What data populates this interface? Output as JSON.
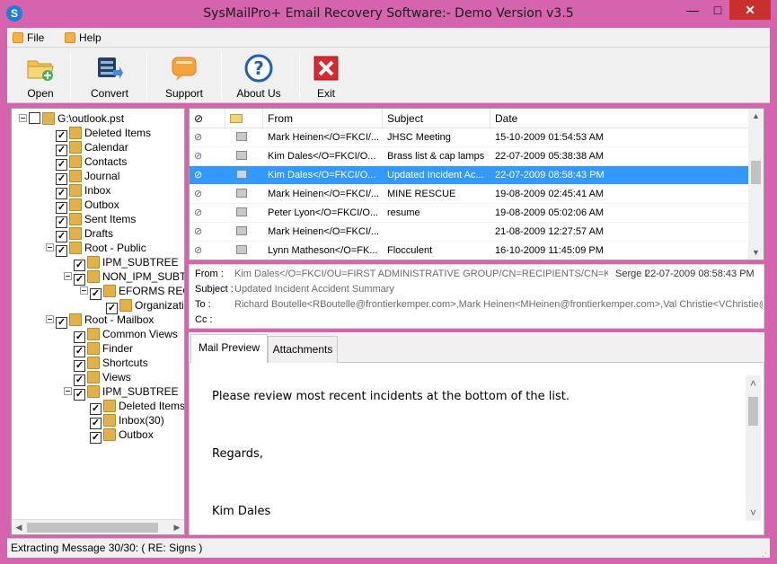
{
  "window": {
    "title": "SysMailPro+ Email Recovery Software:- Demo Version v3.5",
    "app_icon": "S",
    "controls": {
      "minimize": "—",
      "maximize": "□",
      "close": "✕"
    }
  },
  "menu": [
    {
      "label": "File",
      "icon": "file-menu-icon"
    },
    {
      "label": "Help",
      "icon": "help-menu-icon"
    }
  ],
  "toolbar": [
    {
      "label": "Open",
      "icon": "open-folder-icon"
    },
    {
      "label": "Convert",
      "icon": "convert-icon"
    },
    {
      "label": "Support",
      "icon": "support-chat-icon"
    },
    {
      "label": "About Us",
      "icon": "about-question-icon"
    },
    {
      "label": "Exit",
      "icon": "exit-x-icon"
    }
  ],
  "tree": {
    "items": [
      {
        "label": "G:\\outlook.pst",
        "depth": 0,
        "expander": true,
        "checked": false,
        "icon": "pst-file-icon"
      },
      {
        "label": "Deleted Items",
        "depth": 1,
        "expander": false,
        "checked": true,
        "icon": "recycle-folder-icon"
      },
      {
        "label": "Calendar",
        "depth": 1,
        "expander": false,
        "checked": true,
        "icon": "calendar-icon"
      },
      {
        "label": "Contacts",
        "depth": 1,
        "expander": false,
        "checked": true,
        "icon": "contacts-icon"
      },
      {
        "label": "Journal",
        "depth": 1,
        "expander": false,
        "checked": true,
        "icon": "journal-icon"
      },
      {
        "label": "Inbox",
        "depth": 1,
        "expander": false,
        "checked": true,
        "icon": "inbox-envelope-icon"
      },
      {
        "label": "Outbox",
        "depth": 1,
        "expander": false,
        "checked": true,
        "icon": "outbox-icon"
      },
      {
        "label": "Sent Items",
        "depth": 1,
        "expander": false,
        "checked": true,
        "icon": "sent-items-icon"
      },
      {
        "label": "Drafts",
        "depth": 1,
        "expander": false,
        "checked": true,
        "icon": "drafts-icon"
      },
      {
        "label": "Root - Public",
        "depth": 1,
        "expander": true,
        "checked": true,
        "icon": "folder-icon"
      },
      {
        "label": "IPM_SUBTREE",
        "depth": 2,
        "expander": false,
        "checked": true,
        "icon": "folder-icon"
      },
      {
        "label": "NON_IPM_SUBTREE",
        "depth": 2,
        "expander": true,
        "checked": true,
        "icon": "folder-icon"
      },
      {
        "label": "EFORMS REGISTRY",
        "depth": 3,
        "expander": true,
        "checked": true,
        "icon": "folder-icon"
      },
      {
        "label": "Organization Forms",
        "depth": 4,
        "expander": false,
        "checked": true,
        "icon": "folder-icon"
      },
      {
        "label": "Root - Mailbox",
        "depth": 1,
        "expander": true,
        "checked": true,
        "icon": "folder-icon"
      },
      {
        "label": "Common Views",
        "depth": 2,
        "expander": false,
        "checked": true,
        "icon": "folder-icon"
      },
      {
        "label": "Finder",
        "depth": 2,
        "expander": false,
        "checked": true,
        "icon": "folder-icon"
      },
      {
        "label": "Shortcuts",
        "depth": 2,
        "expander": false,
        "checked": true,
        "icon": "folder-icon"
      },
      {
        "label": "Views",
        "depth": 2,
        "expander": false,
        "checked": true,
        "icon": "folder-icon"
      },
      {
        "label": "IPM_SUBTREE",
        "depth": 2,
        "expander": true,
        "checked": true,
        "icon": "folder-icon"
      },
      {
        "label": "Deleted Items",
        "depth": 3,
        "expander": false,
        "checked": true,
        "icon": "recycle-folder-icon"
      },
      {
        "label": "Inbox(30)",
        "depth": 3,
        "expander": false,
        "checked": true,
        "icon": "inbox-envelope-icon"
      },
      {
        "label": "Outbox",
        "depth": 3,
        "expander": false,
        "checked": true,
        "icon": "folder-icon"
      }
    ]
  },
  "message_list": {
    "columns": [
      "",
      "",
      "From",
      "Subject",
      "Date"
    ],
    "rows": [
      {
        "from": "Mark Heinen</O=FKCI/...",
        "subject": "JHSC Meeting",
        "date": "15-10-2009 01:54:53 AM",
        "selected": false
      },
      {
        "from": "Kim Dales</O=FKCI/O...",
        "subject": "Brass list & cap lamps",
        "date": "22-07-2009 05:38:38 AM",
        "selected": false
      },
      {
        "from": "Kim Dales</O=FKCI/O...",
        "subject": "Updated Incident Ac...",
        "date": "22-07-2009 08:58:43 PM",
        "selected": true
      },
      {
        "from": "Mark Heinen</O=FKCI/...",
        "subject": "MINE RESCUE",
        "date": "19-08-2009 02:45:41 AM",
        "selected": false
      },
      {
        "from": "Peter Lyon</O=FKCI/O...",
        "subject": "resume",
        "date": "19-08-2009 05:02:06 AM",
        "selected": false
      },
      {
        "from": "Mark Heinen</O=FKCI/...",
        "subject": "",
        "date": "21-08-2009 12:27:57 AM",
        "selected": false
      },
      {
        "from": "Lynn Matheson</O=FK...",
        "subject": "Flocculent",
        "date": "16-10-2009 11:45:09 PM",
        "selected": false
      }
    ]
  },
  "header": {
    "from_label": "From :",
    "from_value": "Kim Dales</O=FKCI/OU=FIRST ADMINISTRATIVE GROUP/CN=RECIPIENTS/CN=KD",
    "from_extra": "Serge I",
    "date_value": "22-07-2009 08:58:43 PM",
    "subject_label": "Subject :",
    "subject_value": "Updated Incident Accident Summary",
    "to_label": "To :",
    "to_value": "Richard Boutelle<RBoutelle@frontierkemper.com>,Mark Heinen<MHeinen@frontierkemper.com>,Val Christie<VChristie@fron",
    "cc_label": "Cc :",
    "cc_value": ""
  },
  "tabs": [
    {
      "label": "Mail Preview",
      "active": true
    },
    {
      "label": "Attachments",
      "active": false
    }
  ],
  "body": {
    "lines": [
      "Please review most recent incidents at the bottom of the list.",
      "Regards,",
      "Kim Dales"
    ]
  },
  "status": {
    "text": "Extracting Message 30/30: ( RE: Signs )"
  },
  "colors": {
    "window_frame": "#d663ad",
    "selection": "#3399ff",
    "close_button": "#c7302c"
  }
}
